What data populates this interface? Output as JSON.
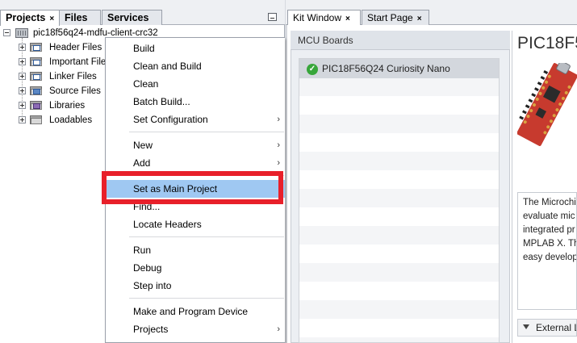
{
  "left_tabs": [
    {
      "label": "Projects",
      "close": "×"
    },
    {
      "label": "Files"
    },
    {
      "label": "Services"
    }
  ],
  "project": {
    "name": "pic18f56q24-mdfu-client-crc32",
    "folders": [
      {
        "label": "Header Files"
      },
      {
        "label": "Important Files"
      },
      {
        "label": "Linker Files"
      },
      {
        "label": "Source Files"
      },
      {
        "label": "Libraries"
      },
      {
        "label": "Loadables"
      }
    ]
  },
  "context_menu": {
    "items": [
      {
        "label": "Build"
      },
      {
        "label": "Clean and Build"
      },
      {
        "label": "Clean"
      },
      {
        "label": "Batch Build..."
      },
      {
        "label": "Set Configuration",
        "submenu": "›"
      },
      {
        "label": "New",
        "submenu": "›"
      },
      {
        "label": "Add",
        "submenu": "›"
      },
      {
        "label": "Set as Main Project",
        "highlighted": true
      },
      {
        "label": "Find..."
      },
      {
        "label": "Locate Headers"
      },
      {
        "label": "Run"
      },
      {
        "label": "Debug"
      },
      {
        "label": "Step into"
      },
      {
        "label": "Make and Program Device"
      },
      {
        "label": "Projects",
        "submenu": "›"
      }
    ]
  },
  "right_tabs": [
    {
      "label": "Kit Window",
      "close": "×"
    },
    {
      "label": "Start Page",
      "close": "×"
    }
  ],
  "kit_window": {
    "boards_header": "MCU Boards",
    "selected_board": "PIC18F56Q24 Curiosity Nano",
    "details_title": "PIC18F5",
    "description_lines": [
      "The Microchi",
      "evaluate mic",
      "integrated pr",
      "MPLAB X. Th",
      "easy develop"
    ],
    "external_section_label": "External L"
  },
  "colors": {
    "menu_highlight": "#9fc8f2",
    "annotation_red": "#e8202a",
    "check_green": "#37a63a"
  }
}
